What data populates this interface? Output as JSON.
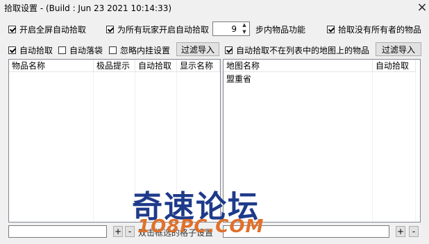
{
  "window": {
    "title": "拾取设置 - (Build : Jun 23 2021 10:14:33)",
    "close_glyph": "×"
  },
  "top_options": {
    "fullscreen_pickup": {
      "label": "开启全屏自动拾取",
      "checked": true
    },
    "all_players_pickup": {
      "label": "为所有玩家开启自动拾取",
      "checked": true
    },
    "step_value": "9",
    "step_label": "步内物品功能",
    "pickup_unowned": {
      "label": "拾取没有所有者的物品",
      "checked": true
    }
  },
  "left_toolbar": {
    "auto_pickup": {
      "label": "自动拾取",
      "checked": true
    },
    "auto_drop": {
      "label": "自动落袋",
      "checked": false
    },
    "ignore_plugin": {
      "label": "忽略内挂设置",
      "checked": false
    },
    "filter_import": "过滤导入"
  },
  "right_toolbar": {
    "pickup_not_in_map_list": {
      "label": "自动拾取不在列表中的地图上的物品",
      "checked": true
    },
    "filter_import": "过滤导入"
  },
  "left_table": {
    "columns": [
      "物品名称",
      "极品提示",
      "自动拾取",
      "显示名称"
    ],
    "rows": []
  },
  "right_table": {
    "columns": [
      "地图名称",
      "自动拾取"
    ],
    "rows": [
      [
        "盟重省",
        ""
      ]
    ]
  },
  "bottom": {
    "left_add": "+",
    "left_remove": "-",
    "middle_text": "双击框选的格子设置",
    "right_add": "+",
    "right_remove": "-"
  },
  "watermark": {
    "cn": "奇速论坛",
    "en": "1O8PC.COM"
  }
}
